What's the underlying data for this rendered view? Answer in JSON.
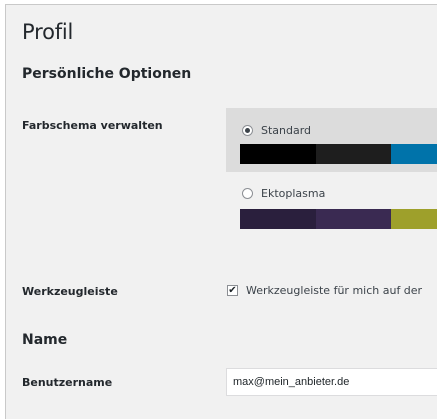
{
  "page": {
    "title": "Profil"
  },
  "personal_options": {
    "heading": "Persönliche Optionen",
    "color_scheme": {
      "label": "Farbschema verwalten",
      "options": [
        {
          "label": "Standard",
          "selected": true,
          "palette": [
            "#000000",
            "#1e1e1e",
            "#0073aa"
          ]
        },
        {
          "label": "Ektoplasma",
          "selected": false,
          "palette": [
            "#2a1f3d",
            "#3a2a52",
            "#9ea02b"
          ]
        }
      ]
    },
    "toolbar": {
      "label": "Werkzeugleiste",
      "checkbox_label": "Werkzeugleiste für mich auf der",
      "checked": true
    }
  },
  "name_section": {
    "heading": "Name",
    "username": {
      "label": "Benutzername",
      "value": "max@mein_anbieter.de"
    }
  }
}
